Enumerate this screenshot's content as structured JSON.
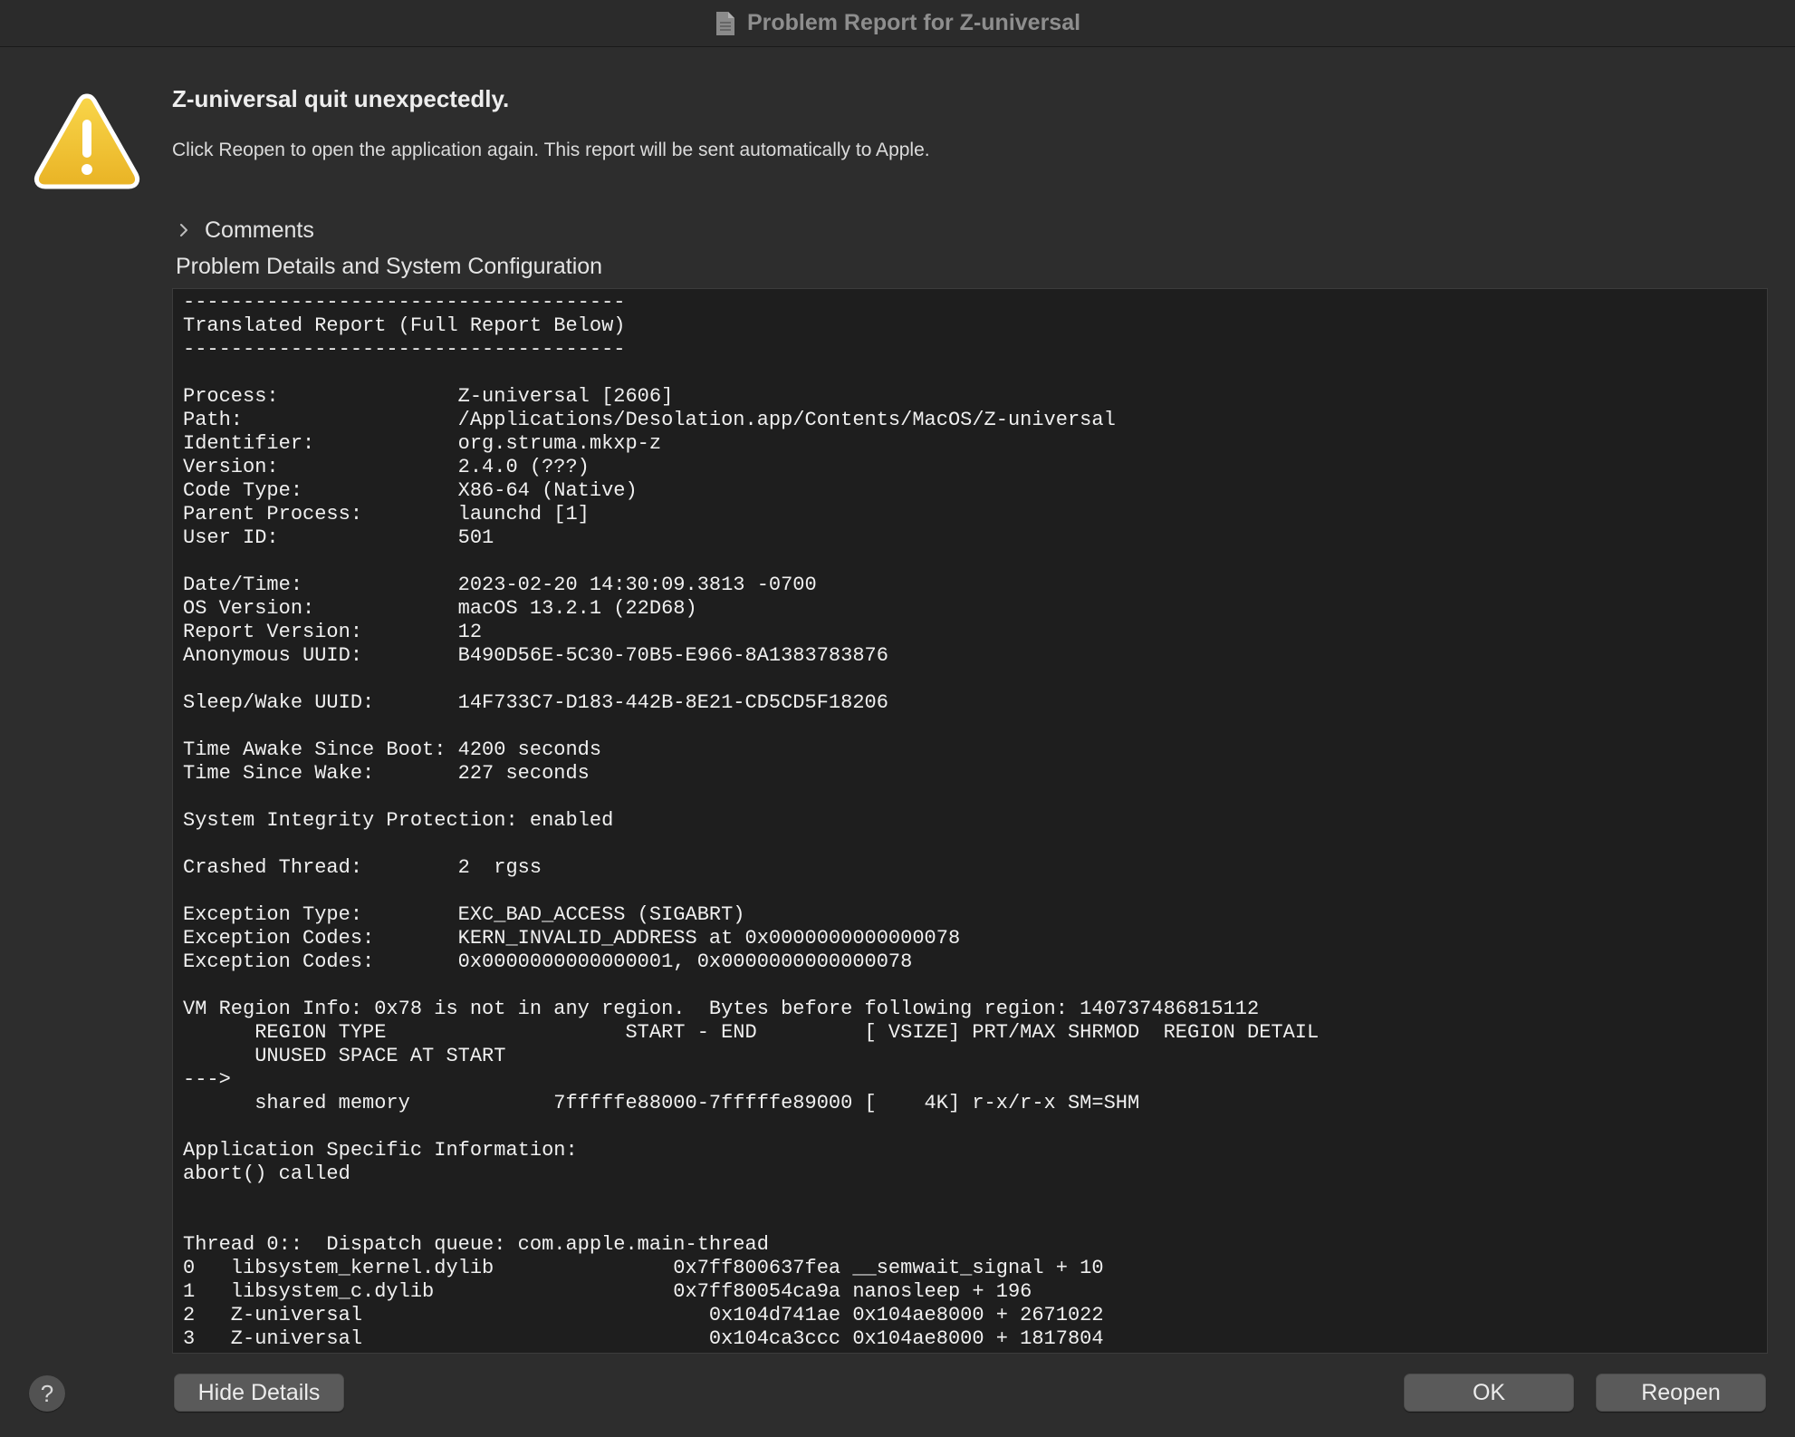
{
  "window": {
    "title": "Problem Report for Z-universal"
  },
  "alert": {
    "headline": "Z-universal quit unexpectedly.",
    "message": "Click Reopen to open the application again. This report will be sent automatically to Apple."
  },
  "comments": {
    "label": "Comments"
  },
  "details": {
    "section_label": "Problem Details and System Configuration",
    "report_lines": [
      "-------------------------------------",
      "Translated Report (Full Report Below)",
      "-------------------------------------",
      "",
      "Process:               Z-universal [2606]",
      "Path:                  /Applications/Desolation.app/Contents/MacOS/Z-universal",
      "Identifier:            org.struma.mkxp-z",
      "Version:               2.4.0 (???)",
      "Code Type:             X86-64 (Native)",
      "Parent Process:        launchd [1]",
      "User ID:               501",
      "",
      "Date/Time:             2023-02-20 14:30:09.3813 -0700",
      "OS Version:            macOS 13.2.1 (22D68)",
      "Report Version:        12",
      "Anonymous UUID:        B490D56E-5C30-70B5-E966-8A1383783876",
      "",
      "Sleep/Wake UUID:       14F733C7-D183-442B-8E21-CD5CD5F18206",
      "",
      "Time Awake Since Boot: 4200 seconds",
      "Time Since Wake:       227 seconds",
      "",
      "System Integrity Protection: enabled",
      "",
      "Crashed Thread:        2  rgss",
      "",
      "Exception Type:        EXC_BAD_ACCESS (SIGABRT)",
      "Exception Codes:       KERN_INVALID_ADDRESS at 0x0000000000000078",
      "Exception Codes:       0x0000000000000001, 0x0000000000000078",
      "",
      "VM Region Info: 0x78 is not in any region.  Bytes before following region: 140737486815112",
      "      REGION TYPE                    START - END         [ VSIZE] PRT/MAX SHRMOD  REGION DETAIL",
      "      UNUSED SPACE AT START",
      "--->",
      "      shared memory            7fffffe88000-7fffffe89000 [    4K] r-x/r-x SM=SHM",
      "",
      "Application Specific Information:",
      "abort() called",
      "",
      "",
      "Thread 0::  Dispatch queue: com.apple.main-thread",
      "0   libsystem_kernel.dylib               0x7ff800637fea __semwait_signal + 10",
      "1   libsystem_c.dylib                    0x7ff80054ca9a nanosleep + 196",
      "2   Z-universal                             0x104d741ae 0x104ae8000 + 2671022",
      "3   Z-universal                             0x104ca3ccc 0x104ae8000 + 1817804"
    ]
  },
  "buttons": {
    "help": "?",
    "hide_details": "Hide Details",
    "ok": "OK",
    "reopen": "Reopen"
  },
  "colors": {
    "window_bg": "#2d2d2d",
    "report_bg": "#1e1e1e",
    "button_bg": "#5a5a5a",
    "warning_yellow": "#f2c230"
  },
  "icons": {
    "title": "document-icon",
    "alert": "warning-triangle-icon",
    "disclosure": "chevron-right-icon"
  }
}
